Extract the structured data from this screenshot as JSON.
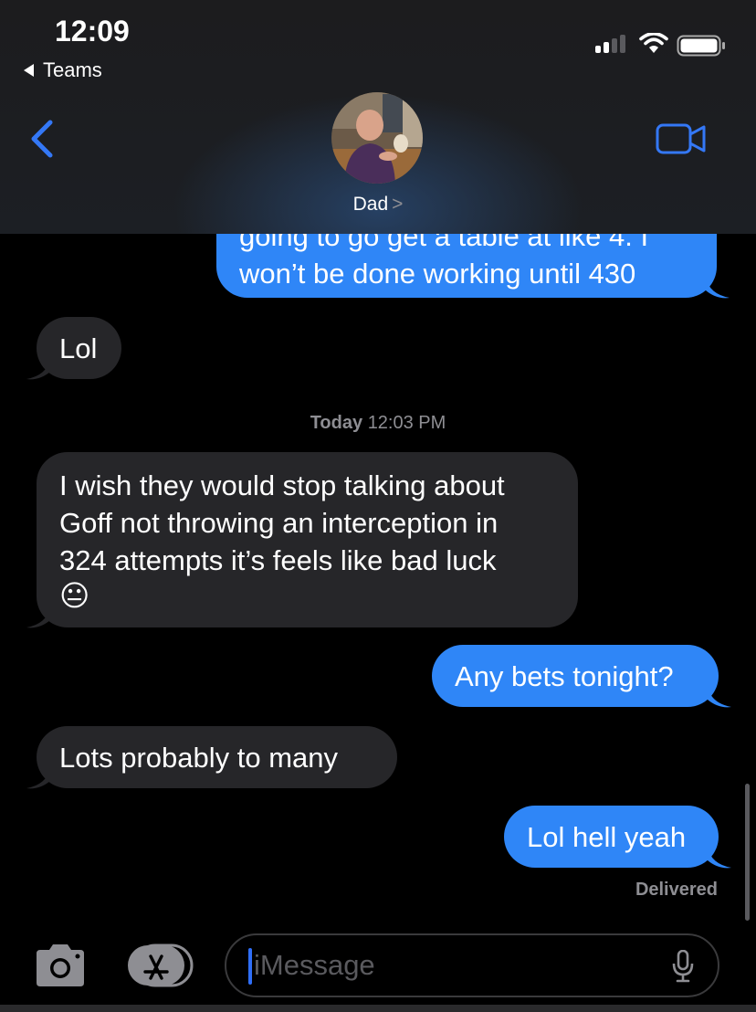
{
  "status_bar": {
    "time": "12:09",
    "back_app": "Teams"
  },
  "header": {
    "contact_name": "Dad",
    "chevron": ">"
  },
  "messages": {
    "m1_partial_line": "going to go get a table at like 4. I",
    "m1_line": "won’t be done working until 430",
    "m2": "Lol",
    "timestamp_day": "Today",
    "timestamp_time": "12:03 PM",
    "m3_line1": "I wish they would stop talking about",
    "m3_line2": "Goff not throwing an interception in",
    "m3_line3": "324 attempts it’s feels like bad luck",
    "m3_emoji": "😐",
    "m4": "Any bets tonight?",
    "m5": "Lots probably to many",
    "m6": "Lol hell yeah",
    "delivered": "Delivered"
  },
  "input_bar": {
    "placeholder": "iMessage"
  },
  "colors": {
    "outgoing": "#2f86f7",
    "incoming": "#262629",
    "accent": "#3478f6"
  }
}
